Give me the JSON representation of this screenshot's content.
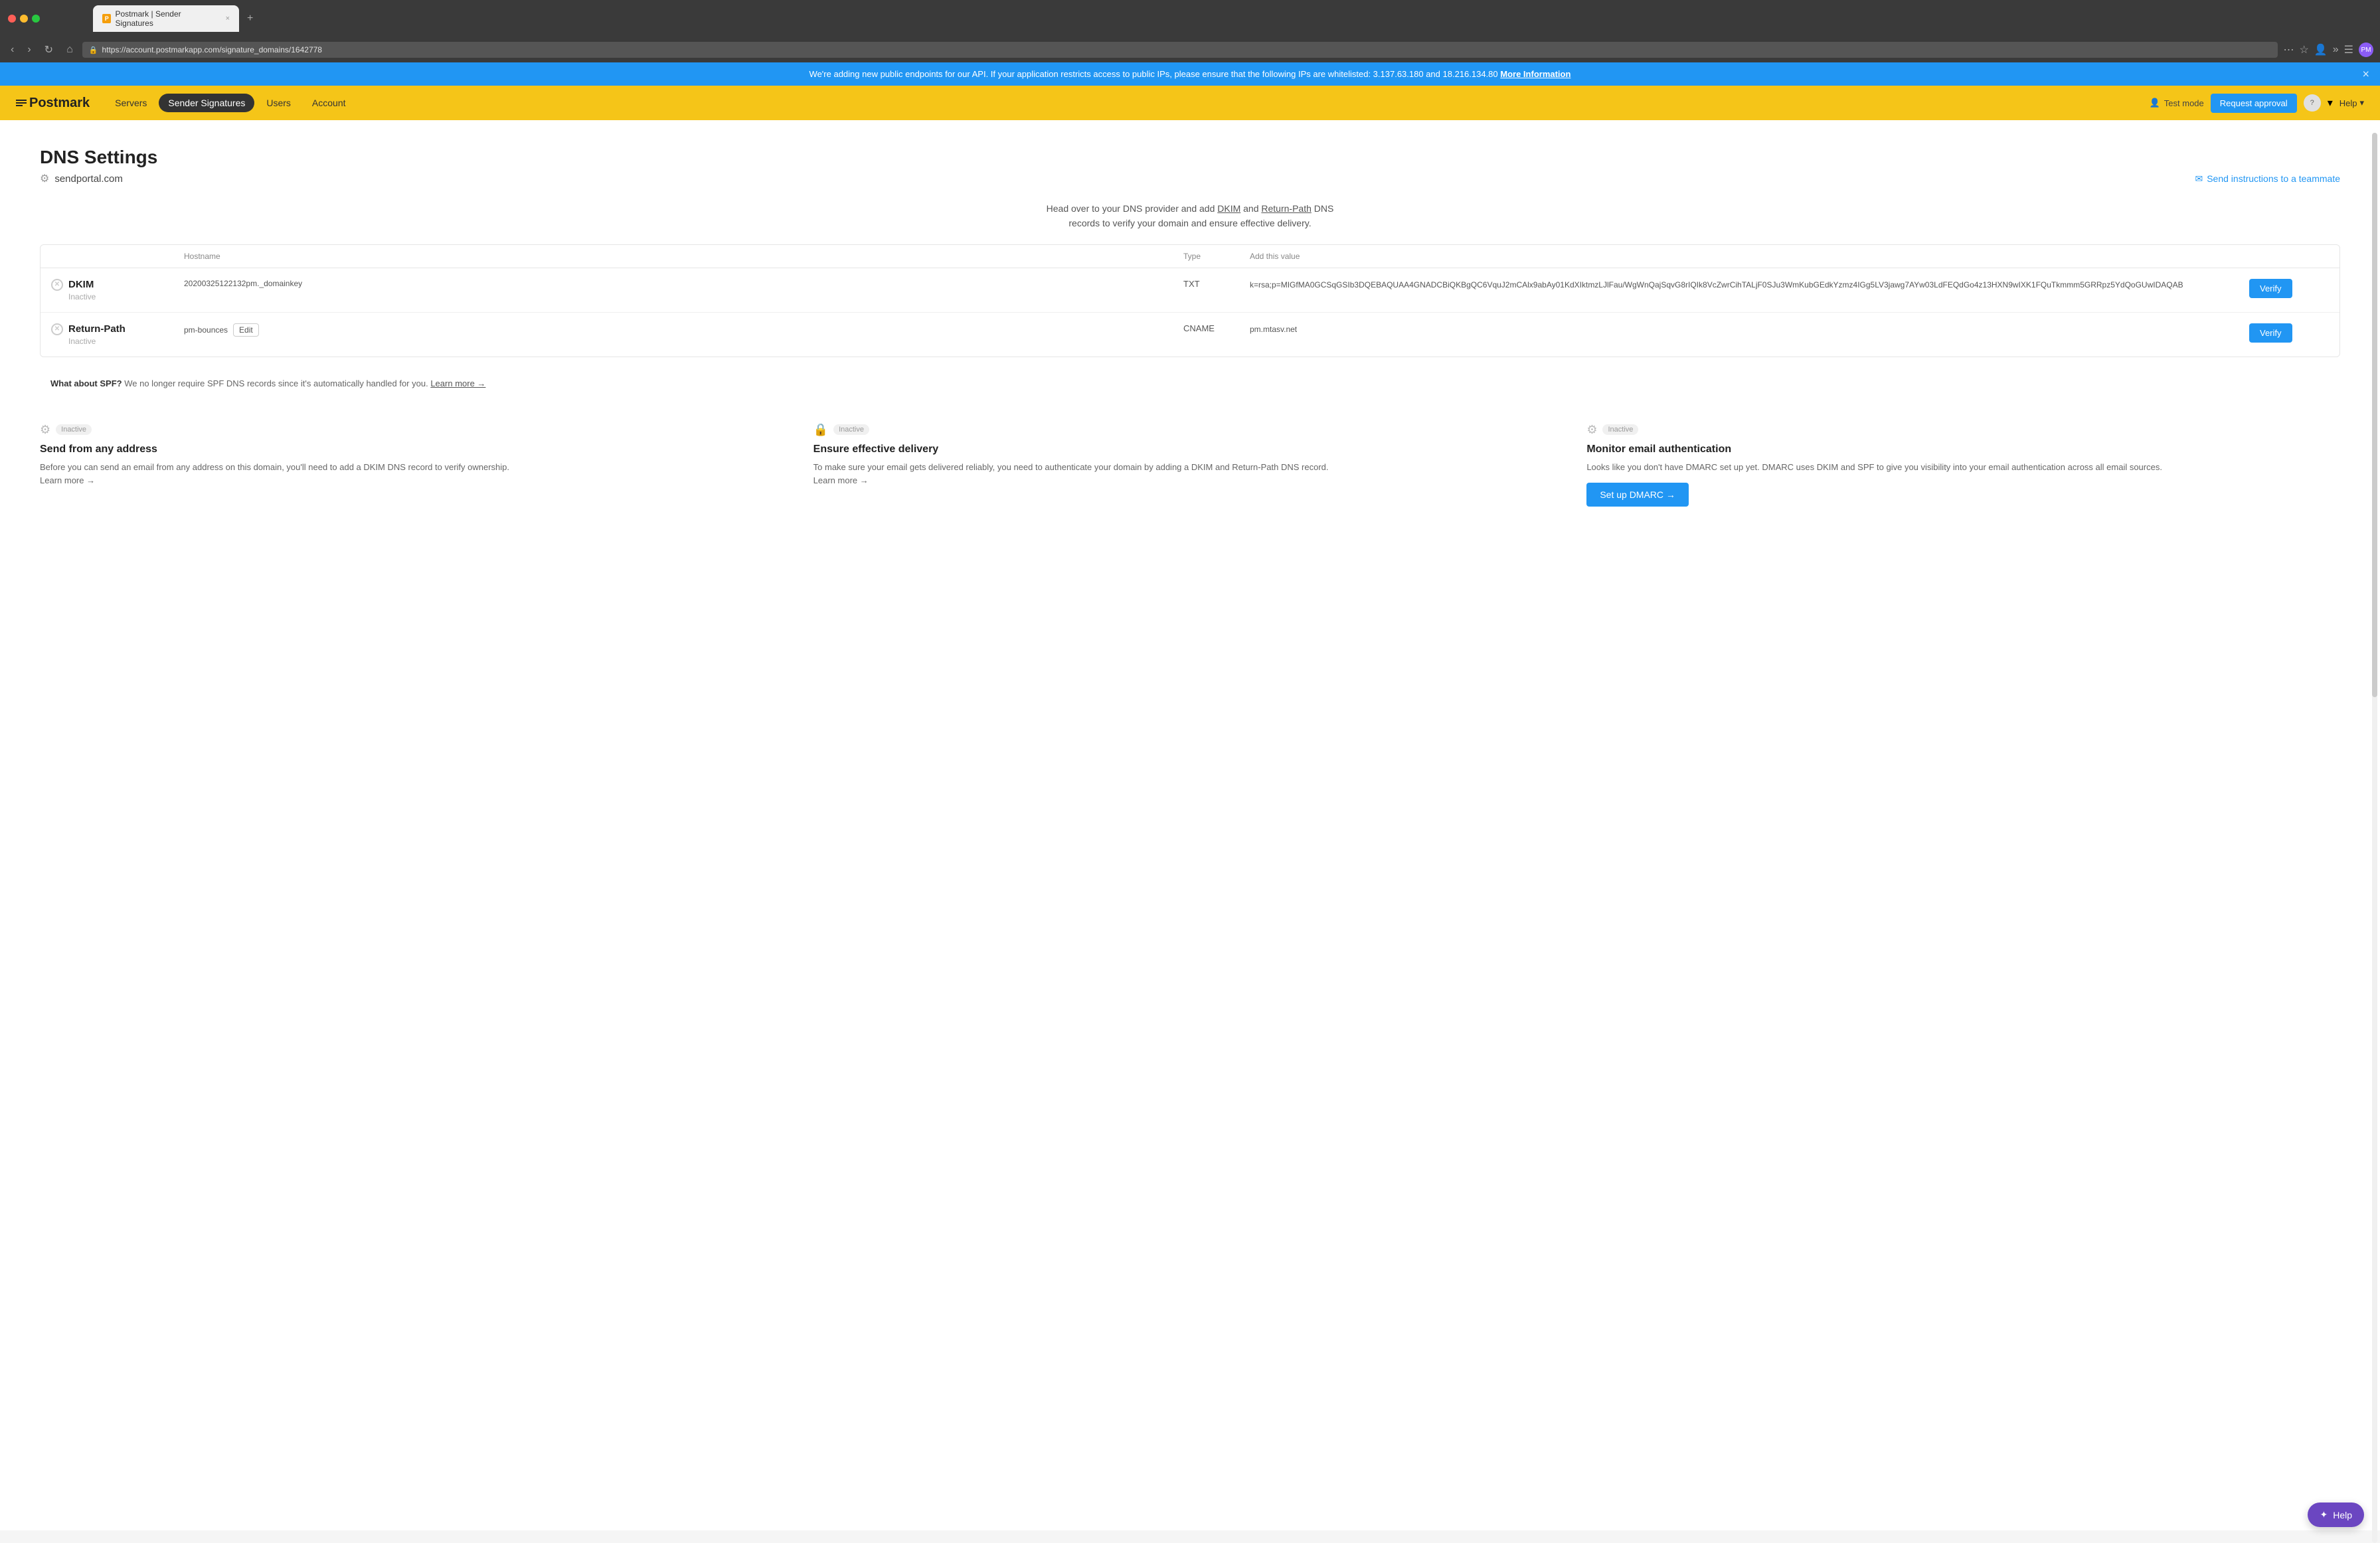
{
  "browser": {
    "url": "https://account.postmarkapp.com/signature_domains/1642778",
    "tab_title": "Postmark | Sender Signatures",
    "tab_favicon_text": "P"
  },
  "banner": {
    "text": "We're adding new public endpoints for our API. If your application restricts access to public IPs, please ensure that the following IPs are whitelisted: 3.137.63.180 and 18.216.134.80",
    "link_text": "More Information",
    "close": "×"
  },
  "nav": {
    "logo_text": "Postmark",
    "items": [
      {
        "label": "Servers",
        "active": false
      },
      {
        "label": "Sender Signatures",
        "active": true
      },
      {
        "label": "Users",
        "active": false
      },
      {
        "label": "Account",
        "active": false
      }
    ],
    "test_mode_label": "Test mode",
    "request_approval_label": "Request approval",
    "help_label": "Help"
  },
  "dns_settings": {
    "title": "DNS Settings",
    "domain": "sendportal.com",
    "send_instructions_label": "Send instructions to a teammate",
    "description_line1": "Head over to your DNS provider and add DKIM and Return-Path DNS",
    "description_line2": "records to verify your domain and ensure effective delivery.",
    "table": {
      "headers": {
        "hostname": "Hostname",
        "type": "Type",
        "add_value": "Add this value"
      },
      "rows": [
        {
          "name": "DKIM",
          "status": "Inactive",
          "hostname": "20200325122132pm._domainkey",
          "type": "TXT",
          "value": "k=rsa;p=MIGfMA0GCSqGSIb3DQEBAQUAA4GNADCBiQKBgQC6VquJ2mCAlx9abAy01KdXIktmzLJlFau/WgWnQajSqvG8rIQIk8VcZwrCihTALjF0SJu3WmKubGEdkYzmz4IGg5LV3jawg7AYw03LdFEQdGo4z13HXN9wIXK1FQuTkmmm5GRRpz5YdQoGUwIDAQAB",
          "verify_label": "Verify"
        },
        {
          "name": "Return-Path",
          "status": "Inactive",
          "hostname": "pm-bounces",
          "edit_label": "Edit",
          "type": "CNAME",
          "value": "pm.mtasv.net",
          "verify_label": "Verify"
        }
      ]
    },
    "spf_notice": {
      "label": "What about SPF?",
      "text": "We no longer require SPF DNS records since it's automatically handled for you.",
      "link_text": "Learn more →"
    },
    "feature_cards": [
      {
        "icon": "⚙",
        "badge": "Inactive",
        "title": "Send from any address",
        "description": "Before you can send an email from any address on this domain, you'll need to add a DKIM DNS record to verify ownership.",
        "learn_more": "Learn more →"
      },
      {
        "icon": "🔒",
        "badge": "Inactive",
        "title": "Ensure effective delivery",
        "description": "To make sure your email gets delivered reliably, you need to authenticate your domain by adding a DKIM and Return-Path DNS record.",
        "learn_more": "Learn more →"
      },
      {
        "icon": "⚙",
        "badge": "Inactive",
        "title": "Monitor email authentication",
        "description": "Looks like you don't have DMARC set up yet. DMARC uses DKIM and SPF to give you visibility into your email authentication across all email sources.",
        "setup_dmarc_label": "Set up DMARC →"
      }
    ]
  },
  "help_widget": {
    "label": "Help"
  }
}
